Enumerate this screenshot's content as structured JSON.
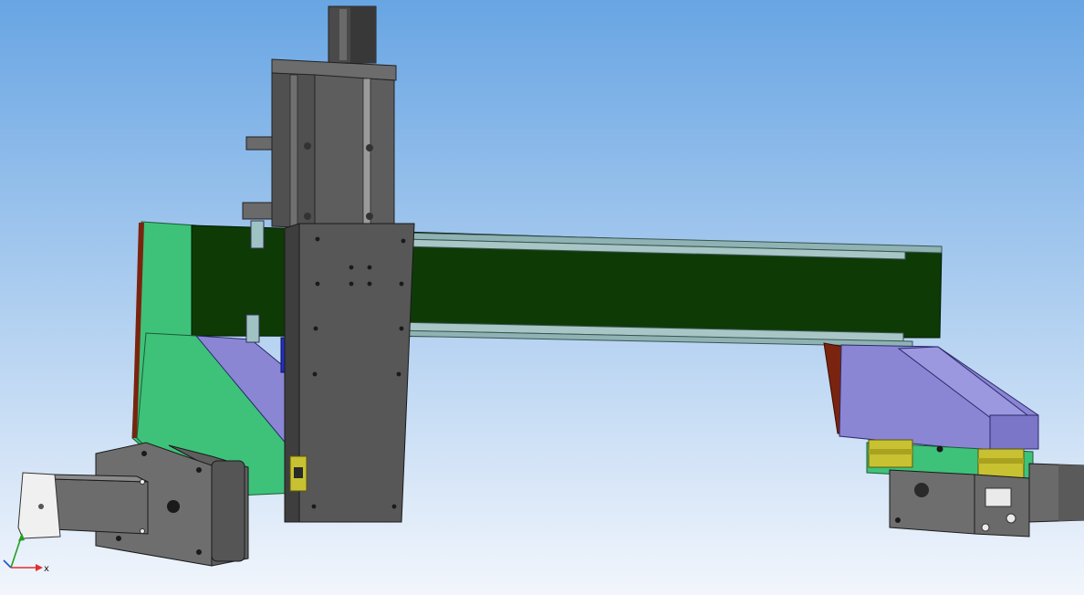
{
  "viewport": {
    "background_top": "#68a5e3",
    "background_bottom": "#f2f6fc"
  },
  "triad": {
    "x_label": "x",
    "x_color": "#e03030",
    "y_color": "#22a022",
    "z_color": "#2050d0"
  },
  "colors": {
    "gantry_beam": "#0e3a06",
    "side_plate": "#3ec27a",
    "rail": "#8fb3b3",
    "column": "#5d5d5d",
    "carriage_plate": "#575757",
    "bracket": "#8a86d4",
    "slider_block": "#c8c232",
    "motor_body": "#6a6a6a",
    "motor_face": "#f0f0f0",
    "accent_red": "#7a2410",
    "block_blue": "#2030c0"
  }
}
